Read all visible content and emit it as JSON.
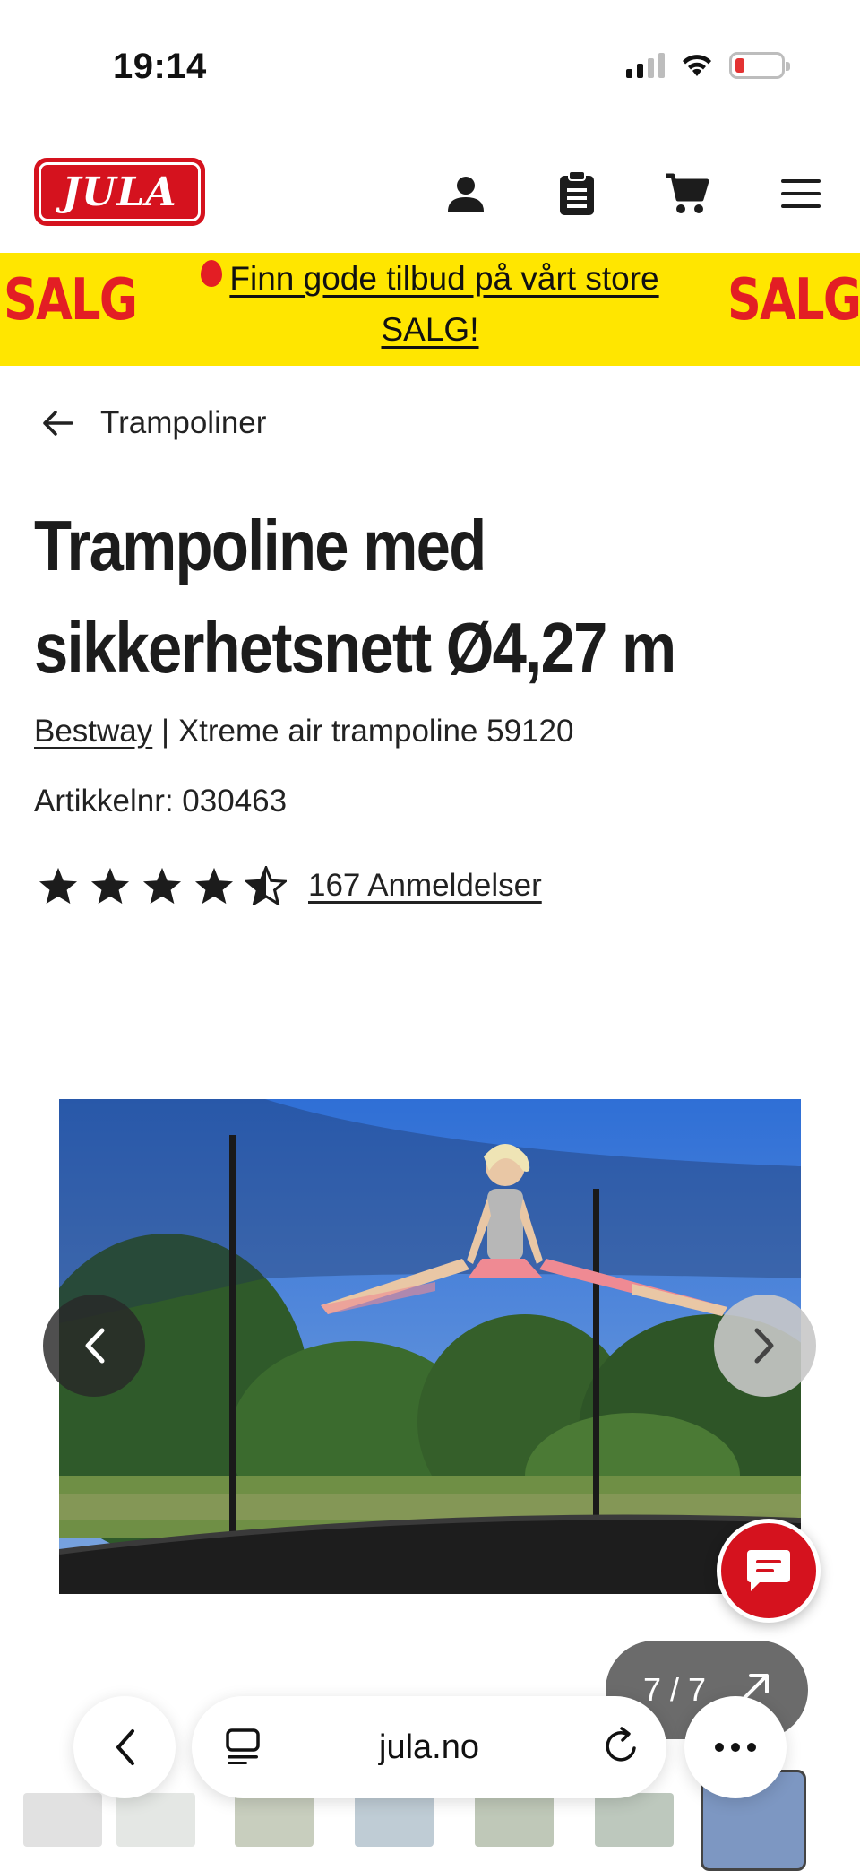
{
  "status_bar": {
    "time": "19:14",
    "battery_level": 0.15
  },
  "header": {
    "logo_text": "JULA",
    "icons": [
      "account-icon",
      "list-icon",
      "cart-icon",
      "menu-icon"
    ]
  },
  "promo": {
    "left_text": "SALG",
    "right_text": "SALG",
    "message": "Finn gode tilbud på vårt store SALG!",
    "background": "#ffe600",
    "accent": "#e31e24"
  },
  "breadcrumb": {
    "label": "Trampoliner"
  },
  "product": {
    "title": "Trampoline med sikkerhetsnett Ø4,27 m",
    "brand": "Bestway",
    "separator": " | ",
    "model": "Xtreme air trampoline 59120",
    "article_number": "Artikkelnr: 030463",
    "rating": 4.5,
    "reviews_label": "167 Anmeldelser"
  },
  "gallery": {
    "counter": "7 / 7",
    "current": 7,
    "total": 7
  },
  "browser": {
    "url": "jula.no"
  },
  "colors": {
    "brand_red": "#d5121e",
    "text": "#1c1c1c"
  }
}
